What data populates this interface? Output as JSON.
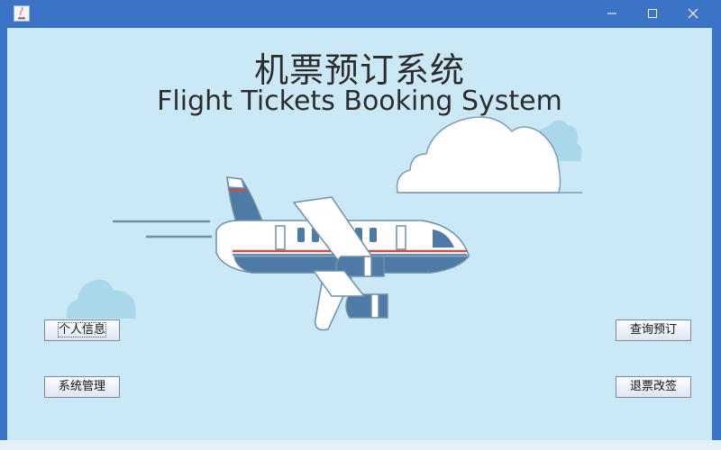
{
  "window": {
    "title": "",
    "controls": {
      "minimize": "minimize",
      "maximize": "maximize",
      "close": "close"
    }
  },
  "header": {
    "title_cn": "机票预订系统",
    "title_en": "Flight Tickets Booking System"
  },
  "buttons": {
    "personal_info": "个人信息",
    "system_management": "系统管理",
    "query_booking": "查询预订",
    "refund_change": "退票改签"
  },
  "colors": {
    "titlebar": "#3b74c6",
    "background": "#cbe8f6",
    "plane_blue": "#4d7ba6",
    "stripe_red": "#c7504f"
  }
}
